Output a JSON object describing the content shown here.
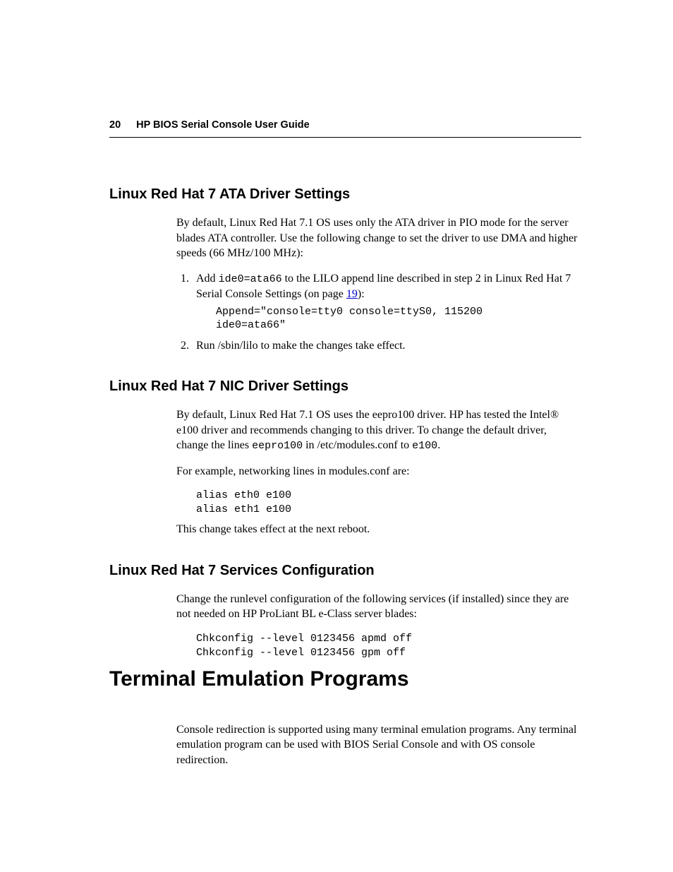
{
  "header": {
    "page_number": "20",
    "title": "HP BIOS Serial Console User Guide"
  },
  "s1": {
    "heading": "Linux Red Hat 7 ATA Driver Settings",
    "intro": "By default, Linux Red Hat 7.1 OS uses only the ATA driver in PIO mode for the server blades ATA controller. Use the following change to set the driver to use DMA and higher speeds (66 MHz/100 MHz):",
    "step1_a": "Add ",
    "step1_code": "ide0=ata66",
    "step1_b": " to the LILO append line described in step 2 in Linux Red Hat 7 Serial Console Settings (on page ",
    "step1_link": "19",
    "step1_c": "):",
    "code1": "Append=\"console=tty0 console=ttyS0, 115200\nide0=ata66\"",
    "step2": "Run /sbin/lilo to make the changes take effect."
  },
  "s2": {
    "heading": "Linux Red Hat 7 NIC Driver Settings",
    "p1_a": "By default, Linux Red Hat 7.1 OS uses the eepro100 driver. HP has tested the Intel® e100 driver and recommends changing to this driver. To change the default driver, change the lines ",
    "p1_code1": "eepro100",
    "p1_b": " in /etc/modules.conf to ",
    "p1_code2": "e100",
    "p1_c": ".",
    "p2": "For example, networking lines in modules.conf are:",
    "code1": "alias eth0 e100\nalias eth1 e100",
    "p3": "This change takes effect at the next reboot."
  },
  "s3": {
    "heading": "Linux Red Hat 7 Services Configuration",
    "p1": "Change the runlevel configuration of the following services (if installed) since they are not needed on HP ProLiant BL e-Class server blades:",
    "code1": "Chkconfig --level 0123456 apmd off\nChkconfig --level 0123456 gpm off"
  },
  "s4": {
    "heading": "Terminal Emulation Programs",
    "p1": "Console redirection is supported using many terminal emulation programs. Any terminal emulation program can be used with BIOS Serial Console and with OS console redirection."
  }
}
